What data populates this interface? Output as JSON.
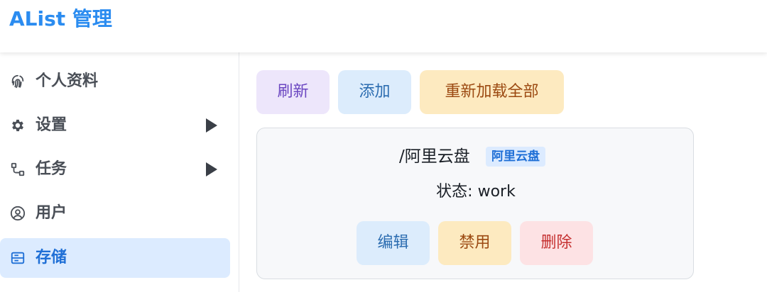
{
  "header": {
    "title": "AList 管理"
  },
  "sidebar": {
    "items": [
      {
        "label": "个人资料",
        "icon": "fingerprint-icon",
        "has_submenu": false,
        "active": false
      },
      {
        "label": "设置",
        "icon": "gear-icon",
        "has_submenu": true,
        "active": false
      },
      {
        "label": "任务",
        "icon": "workflow-icon",
        "has_submenu": true,
        "active": false
      },
      {
        "label": "用户",
        "icon": "user-circle-icon",
        "has_submenu": false,
        "active": false
      },
      {
        "label": "存储",
        "icon": "storage-icon",
        "has_submenu": false,
        "active": true
      }
    ]
  },
  "toolbar": {
    "refresh_label": "刷新",
    "add_label": "添加",
    "reload_all_label": "重新加载全部"
  },
  "storage_card": {
    "mount_path": "/阿里云盘",
    "driver": "阿里云盘",
    "status_text": "状态: work",
    "edit_label": "编辑",
    "disable_label": "禁用",
    "delete_label": "删除"
  },
  "colors": {
    "brand": "#2b8cf0",
    "active_bg": "#dcebff",
    "active_text": "#1f6fd6"
  }
}
